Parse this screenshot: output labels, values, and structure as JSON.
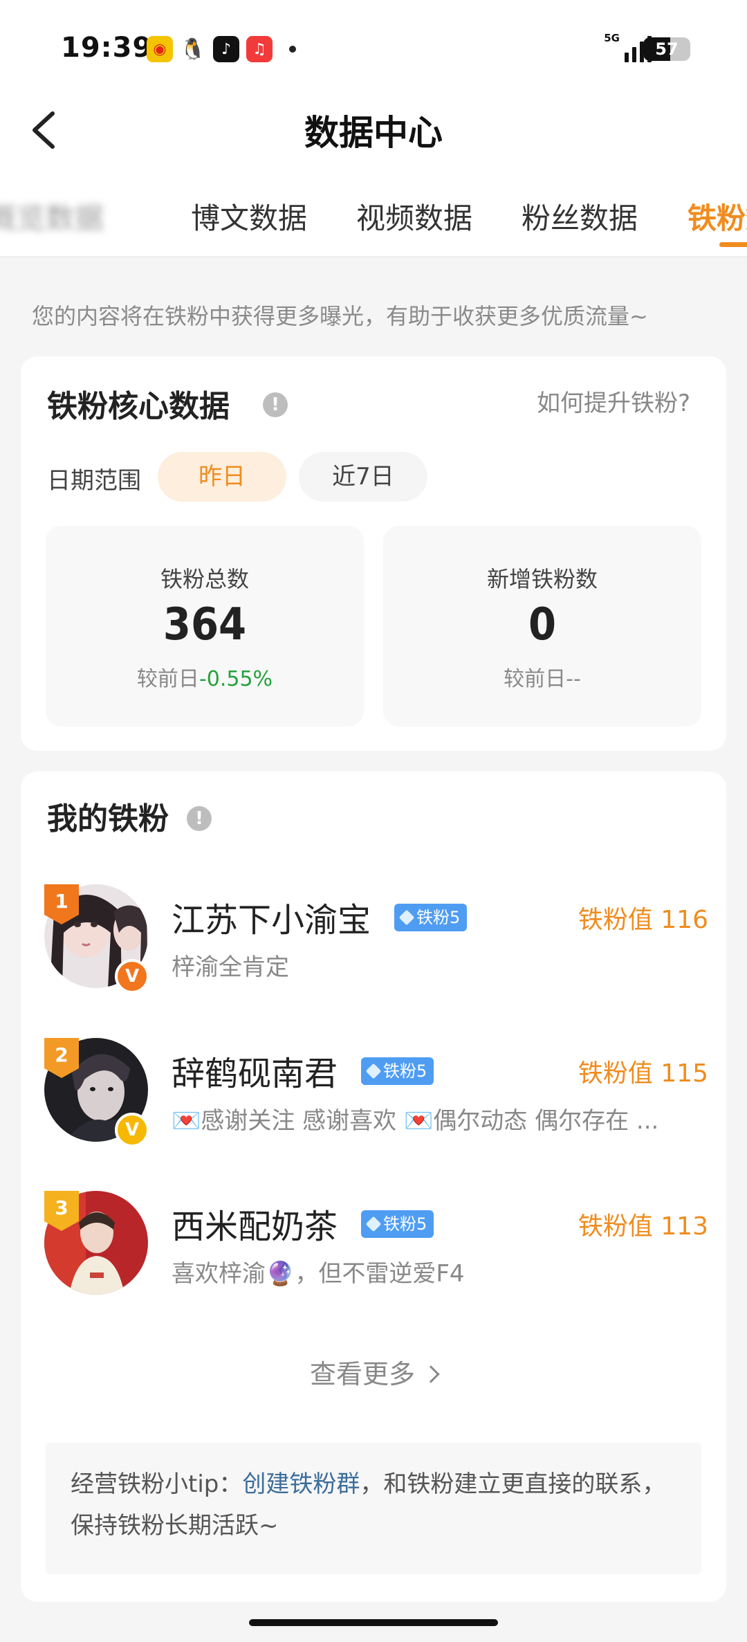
{
  "status_bar": {
    "time": "19:39",
    "apps": [
      {
        "name": "weibo-icon",
        "glyph": "◉"
      },
      {
        "name": "qq-icon",
        "glyph": "🐧"
      },
      {
        "name": "tiktok-icon",
        "glyph": "♪"
      },
      {
        "name": "music-icon",
        "glyph": "♫"
      }
    ],
    "network": "5G",
    "battery": "57"
  },
  "header": {
    "title": "数据中心",
    "tabs": [
      {
        "label": "概览数据",
        "state": "blurred"
      },
      {
        "label": "博文数据",
        "state": "normal"
      },
      {
        "label": "视频数据",
        "state": "normal"
      },
      {
        "label": "粉丝数据",
        "state": "normal"
      },
      {
        "label": "铁粉数据",
        "state": "active"
      }
    ]
  },
  "notice": "您的内容将在铁粉中获得更多曝光，有助于收获更多优质流量~",
  "core": {
    "title": "铁粉核心数据",
    "info_icon": "!",
    "how_link": "如何提升铁粉?",
    "date_label": "日期范围",
    "date_options": [
      "昨日",
      "近7日"
    ],
    "selected_date": "昨日",
    "stats": [
      {
        "label": "铁粉总数",
        "value": "364",
        "compare_prefix": "较前日",
        "compare_value": "-0.55%"
      },
      {
        "label": "新增铁粉数",
        "value": "0",
        "compare_prefix": "较前日",
        "compare_value": "--"
      }
    ]
  },
  "fans": {
    "title": "我的铁粉",
    "info_icon": "!",
    "list": [
      {
        "rank": "1",
        "name": "江苏下小渝宝",
        "level": "铁粉5",
        "value": "铁粉值 116",
        "desc": "梓渝全肯定",
        "verified": "V"
      },
      {
        "rank": "2",
        "name": "辞鹤砚南君",
        "level": "铁粉5",
        "value": "铁粉值 115",
        "desc": "💌感谢关注 感谢喜欢 💌偶尔动态 偶尔存在 ...",
        "verified": "V"
      },
      {
        "rank": "3",
        "name": "西米配奶茶",
        "level": "铁粉5",
        "value": "铁粉值 113",
        "desc": "喜欢梓渝🔮，但不雷逆爱F4",
        "verified": ""
      }
    ],
    "see_more": "查看更多",
    "tip_prefix": "经营铁粉小tip：",
    "tip_link": "创建铁粉群",
    "tip_suffix": "，和铁粉建立更直接的联系，保持铁粉长期活跃~"
  },
  "colors": {
    "accent": "#f08c1e",
    "positive_change": "#23a23b",
    "link": "#3c6e9c",
    "level_badge": "#4f9df3",
    "verified_orange": "#f2761e",
    "verified_yellow": "#f6b800"
  }
}
